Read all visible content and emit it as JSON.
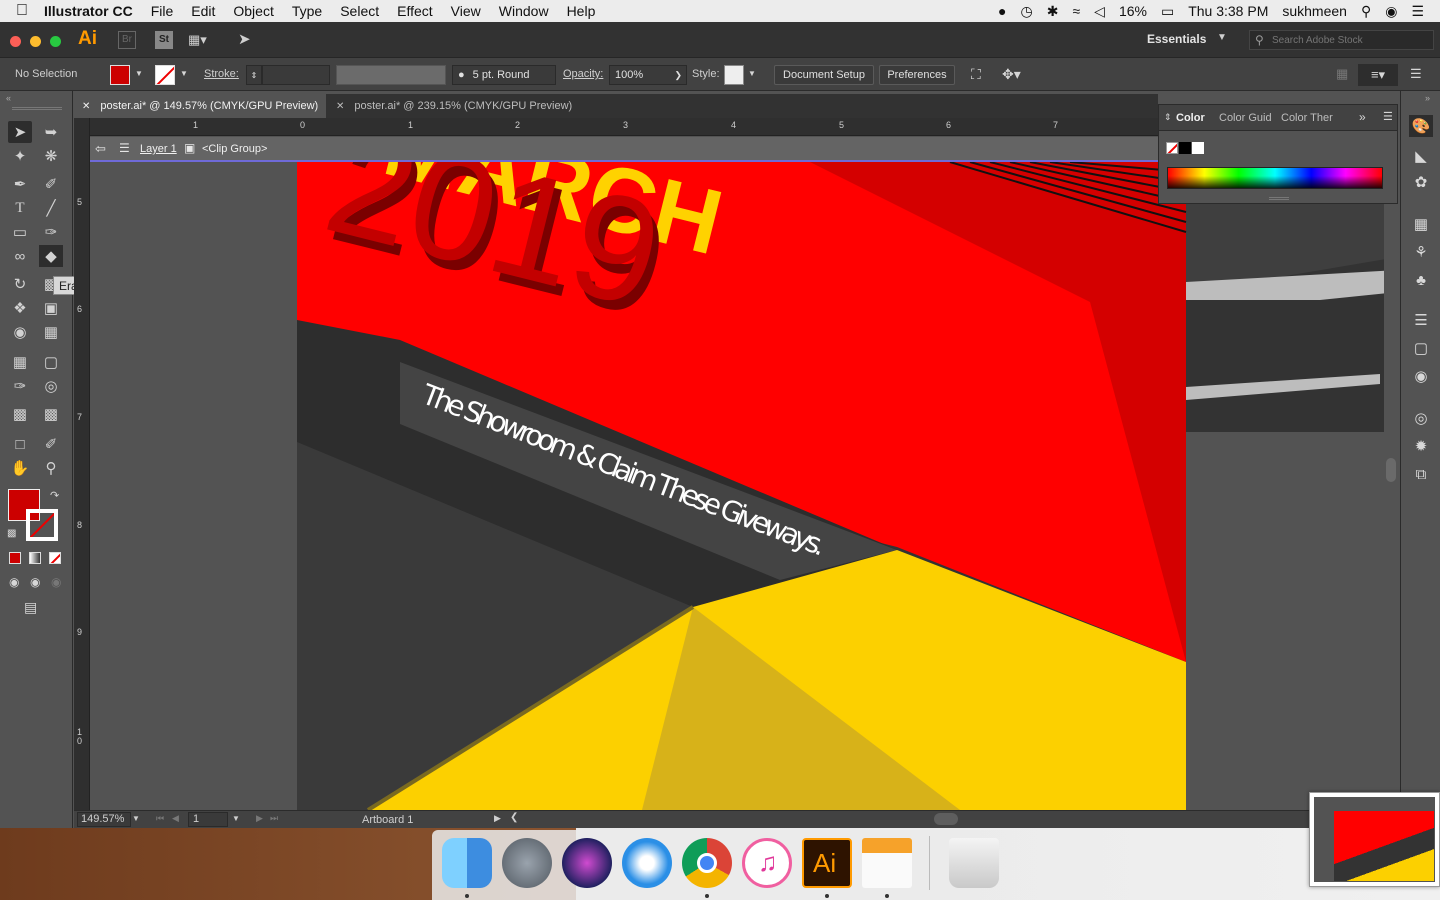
{
  "menubar": {
    "app_name": "Illustrator CC",
    "items": [
      "File",
      "Edit",
      "Object",
      "Type",
      "Select",
      "Effect",
      "View",
      "Window",
      "Help"
    ],
    "battery": "16%",
    "clock": "Thu 3:38 PM",
    "user": "sukhmeen"
  },
  "appbar": {
    "ai_logo": "Ai",
    "bridge_label": "Br",
    "stock_label": "St",
    "workspace": "Essentials",
    "search_placeholder": "Search Adobe Stock"
  },
  "control": {
    "selection_label": "No Selection",
    "stroke_label": "Stroke:",
    "brush": "5 pt. Round",
    "opacity_label": "Opacity:",
    "opacity_value": "100%",
    "style_label": "Style:",
    "document_setup": "Document Setup",
    "preferences": "Preferences",
    "fill_color": "#cc0000"
  },
  "tabs": [
    {
      "label": "poster.ai* @ 149.57% (CMYK/GPU Preview)",
      "active": true
    },
    {
      "label": "poster.ai* @ 239.15% (CMYK/GPU Preview)",
      "active": false
    }
  ],
  "ruler": {
    "h_ticks": [
      "1",
      "0",
      "1",
      "2",
      "3",
      "4",
      "5",
      "6",
      "7"
    ],
    "v_ticks": [
      "5",
      "6",
      "7",
      "8",
      "9",
      "10"
    ]
  },
  "isolation": {
    "layer": "Layer 1",
    "group": "<Clip Group>"
  },
  "tooltip": "Eraser Tool (Shift+E)",
  "artwork": {
    "month_text": "MARCH",
    "year_text": "2019",
    "tagline": "The Showroom & Claim These Giveways.",
    "colors": {
      "red": "#ff0000",
      "dark_red": "#d40000",
      "yellow": "#fcd000",
      "mustard": "#d7b219",
      "charcoal": "#333333"
    }
  },
  "color_panel": {
    "tabs": [
      "Color",
      "Color Guid",
      "Color Ther"
    ]
  },
  "status": {
    "zoom": "149.57%",
    "artboard_num": "1",
    "artboard_name": "Artboard 1"
  },
  "dock": {
    "apps": [
      "Finder",
      "Launchpad",
      "Siri",
      "Safari",
      "Chrome",
      "iTunes",
      "Illustrator",
      "Pages",
      "Trash"
    ],
    "ai_label": "Ai"
  }
}
